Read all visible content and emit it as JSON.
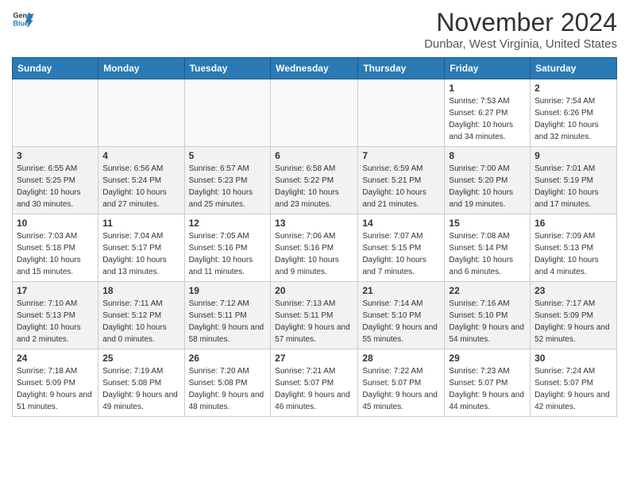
{
  "header": {
    "logo_general": "General",
    "logo_blue": "Blue",
    "month": "November 2024",
    "location": "Dunbar, West Virginia, United States"
  },
  "weekdays": [
    "Sunday",
    "Monday",
    "Tuesday",
    "Wednesday",
    "Thursday",
    "Friday",
    "Saturday"
  ],
  "weeks": [
    [
      {
        "day": "",
        "empty": true
      },
      {
        "day": "",
        "empty": true
      },
      {
        "day": "",
        "empty": true
      },
      {
        "day": "",
        "empty": true
      },
      {
        "day": "",
        "empty": true
      },
      {
        "day": "1",
        "sunrise": "7:53 AM",
        "sunset": "6:27 PM",
        "daylight": "10 hours and 34 minutes."
      },
      {
        "day": "2",
        "sunrise": "7:54 AM",
        "sunset": "6:26 PM",
        "daylight": "10 hours and 32 minutes."
      }
    ],
    [
      {
        "day": "3",
        "sunrise": "6:55 AM",
        "sunset": "5:25 PM",
        "daylight": "10 hours and 30 minutes."
      },
      {
        "day": "4",
        "sunrise": "6:56 AM",
        "sunset": "5:24 PM",
        "daylight": "10 hours and 27 minutes."
      },
      {
        "day": "5",
        "sunrise": "6:57 AM",
        "sunset": "5:23 PM",
        "daylight": "10 hours and 25 minutes."
      },
      {
        "day": "6",
        "sunrise": "6:58 AM",
        "sunset": "5:22 PM",
        "daylight": "10 hours and 23 minutes."
      },
      {
        "day": "7",
        "sunrise": "6:59 AM",
        "sunset": "5:21 PM",
        "daylight": "10 hours and 21 minutes."
      },
      {
        "day": "8",
        "sunrise": "7:00 AM",
        "sunset": "5:20 PM",
        "daylight": "10 hours and 19 minutes."
      },
      {
        "day": "9",
        "sunrise": "7:01 AM",
        "sunset": "5:19 PM",
        "daylight": "10 hours and 17 minutes."
      }
    ],
    [
      {
        "day": "10",
        "sunrise": "7:03 AM",
        "sunset": "5:18 PM",
        "daylight": "10 hours and 15 minutes."
      },
      {
        "day": "11",
        "sunrise": "7:04 AM",
        "sunset": "5:17 PM",
        "daylight": "10 hours and 13 minutes."
      },
      {
        "day": "12",
        "sunrise": "7:05 AM",
        "sunset": "5:16 PM",
        "daylight": "10 hours and 11 minutes."
      },
      {
        "day": "13",
        "sunrise": "7:06 AM",
        "sunset": "5:16 PM",
        "daylight": "10 hours and 9 minutes."
      },
      {
        "day": "14",
        "sunrise": "7:07 AM",
        "sunset": "5:15 PM",
        "daylight": "10 hours and 7 minutes."
      },
      {
        "day": "15",
        "sunrise": "7:08 AM",
        "sunset": "5:14 PM",
        "daylight": "10 hours and 6 minutes."
      },
      {
        "day": "16",
        "sunrise": "7:09 AM",
        "sunset": "5:13 PM",
        "daylight": "10 hours and 4 minutes."
      }
    ],
    [
      {
        "day": "17",
        "sunrise": "7:10 AM",
        "sunset": "5:13 PM",
        "daylight": "10 hours and 2 minutes."
      },
      {
        "day": "18",
        "sunrise": "7:11 AM",
        "sunset": "5:12 PM",
        "daylight": "10 hours and 0 minutes."
      },
      {
        "day": "19",
        "sunrise": "7:12 AM",
        "sunset": "5:11 PM",
        "daylight": "9 hours and 58 minutes."
      },
      {
        "day": "20",
        "sunrise": "7:13 AM",
        "sunset": "5:11 PM",
        "daylight": "9 hours and 57 minutes."
      },
      {
        "day": "21",
        "sunrise": "7:14 AM",
        "sunset": "5:10 PM",
        "daylight": "9 hours and 55 minutes."
      },
      {
        "day": "22",
        "sunrise": "7:16 AM",
        "sunset": "5:10 PM",
        "daylight": "9 hours and 54 minutes."
      },
      {
        "day": "23",
        "sunrise": "7:17 AM",
        "sunset": "5:09 PM",
        "daylight": "9 hours and 52 minutes."
      }
    ],
    [
      {
        "day": "24",
        "sunrise": "7:18 AM",
        "sunset": "5:09 PM",
        "daylight": "9 hours and 51 minutes."
      },
      {
        "day": "25",
        "sunrise": "7:19 AM",
        "sunset": "5:08 PM",
        "daylight": "9 hours and 49 minutes."
      },
      {
        "day": "26",
        "sunrise": "7:20 AM",
        "sunset": "5:08 PM",
        "daylight": "9 hours and 48 minutes."
      },
      {
        "day": "27",
        "sunrise": "7:21 AM",
        "sunset": "5:07 PM",
        "daylight": "9 hours and 46 minutes."
      },
      {
        "day": "28",
        "sunrise": "7:22 AM",
        "sunset": "5:07 PM",
        "daylight": "9 hours and 45 minutes."
      },
      {
        "day": "29",
        "sunrise": "7:23 AM",
        "sunset": "5:07 PM",
        "daylight": "9 hours and 44 minutes."
      },
      {
        "day": "30",
        "sunrise": "7:24 AM",
        "sunset": "5:07 PM",
        "daylight": "9 hours and 42 minutes."
      }
    ]
  ]
}
